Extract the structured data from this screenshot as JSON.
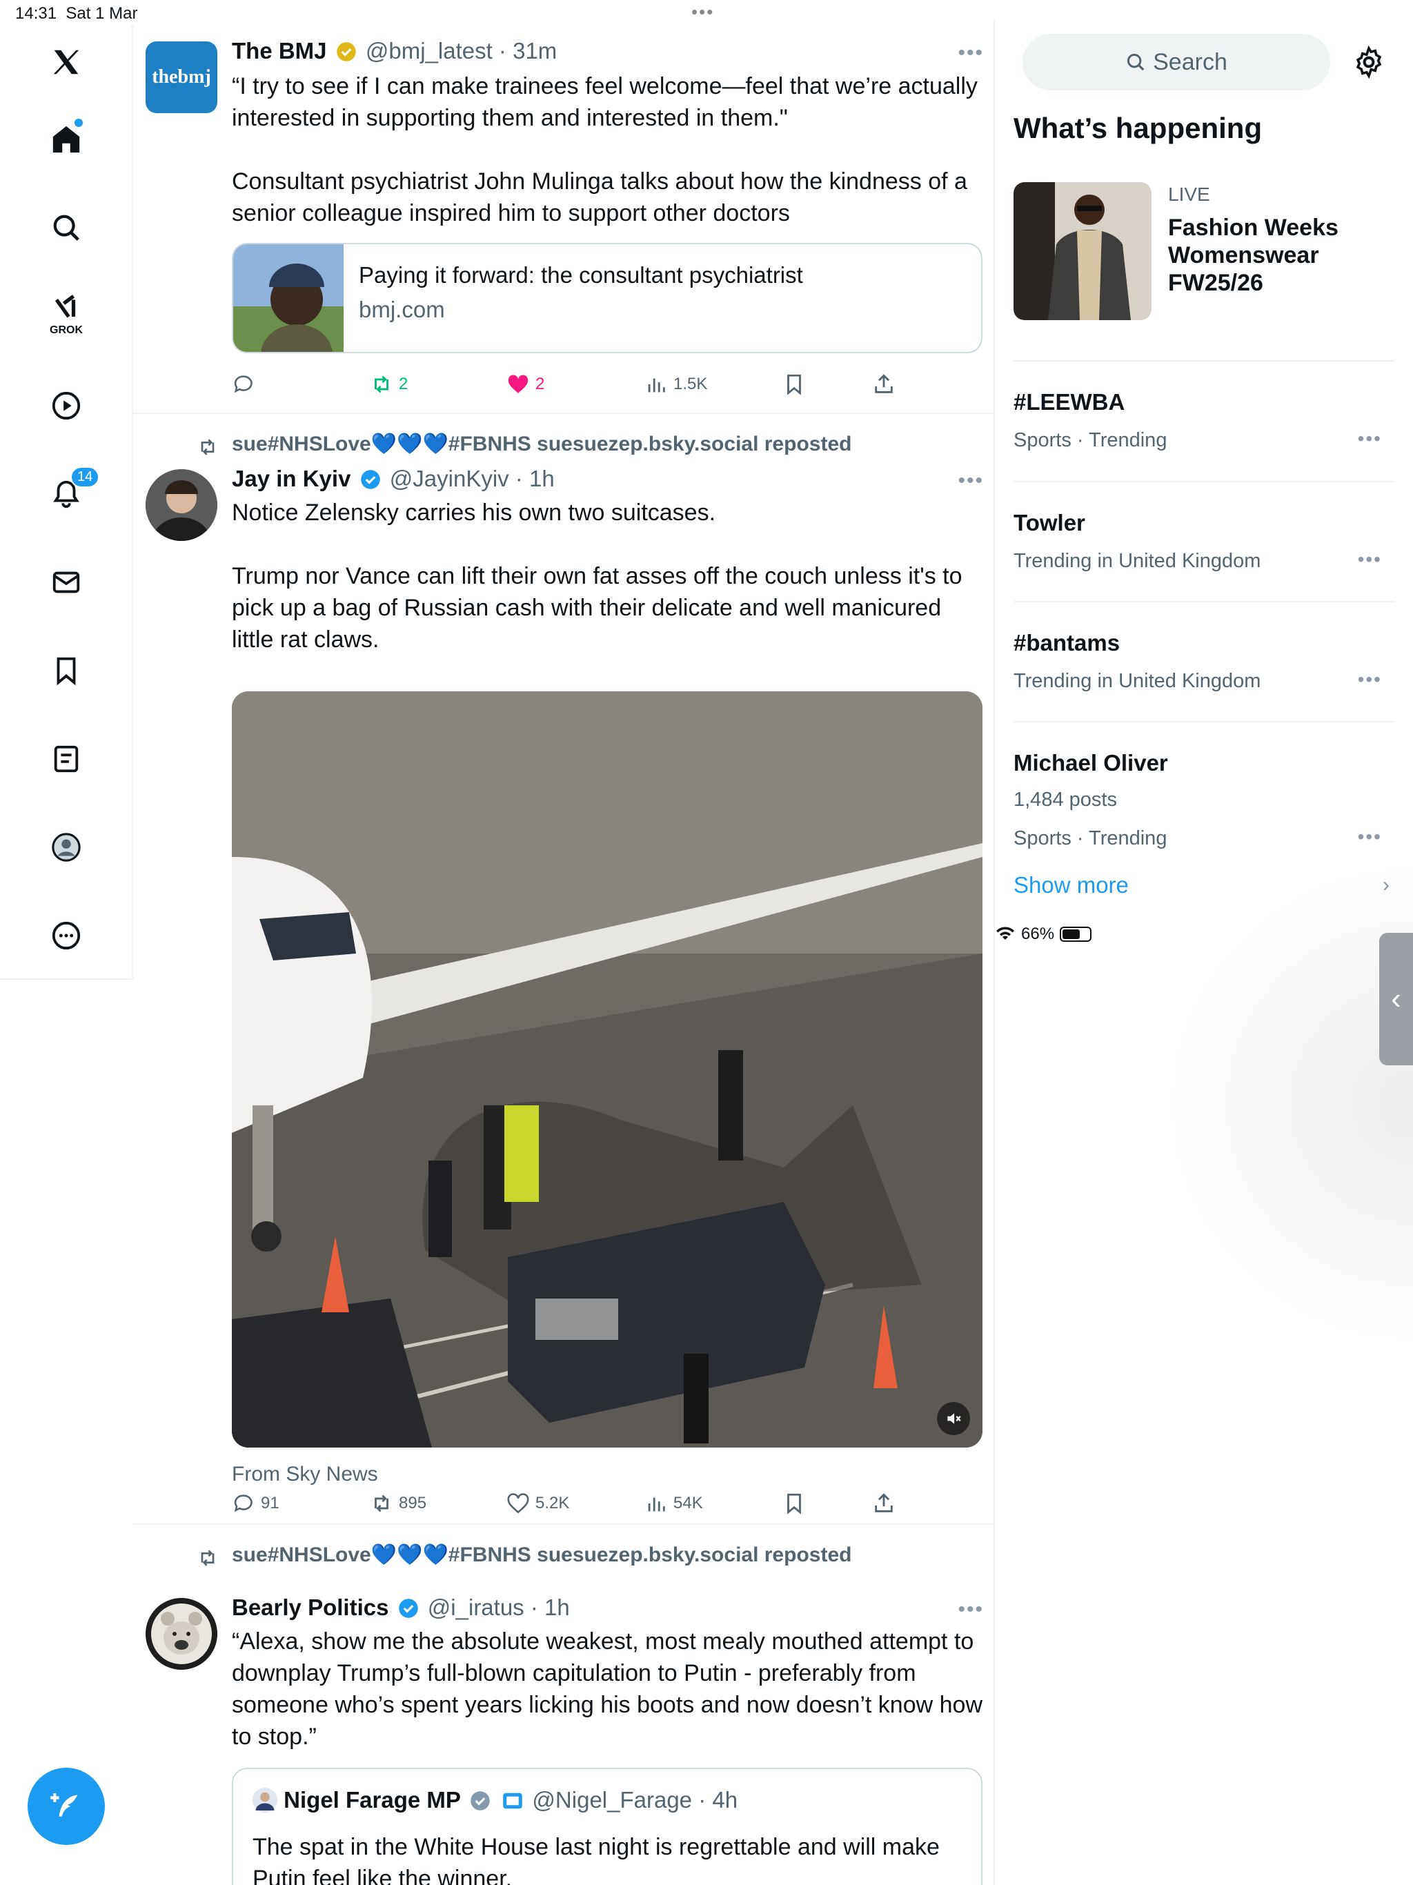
{
  "status_bar": {
    "time": "14:31",
    "date": "Sat 1 Mar",
    "battery": "66%",
    "battery_level": 0.66
  },
  "nav": {
    "items": [
      "x-logo",
      "home",
      "search",
      "grok",
      "video",
      "notifications",
      "messages",
      "bookmarks",
      "lists",
      "profile",
      "more"
    ],
    "grok_label": "GROK",
    "notifications_badge": "14"
  },
  "timeline": {
    "tweet1": {
      "name": "The BMJ",
      "handle": "@bmj_latest",
      "time": "31m",
      "avatar_text": "thebmj",
      "text_line1": "“I try to see if I can make trainees feel welcome—feel that we’re actually interested in supporting them and interested in them.\"",
      "text_line2": "Consultant psychiatrist John Mulinga talks about how the kindness of a senior colleague inspired him to support other doctors",
      "card_title": "Paying it forward: the consultant psychiatrist",
      "card_domain": "bmj.com",
      "reposts": "2",
      "likes": "2",
      "views": "1.5K"
    },
    "tweet2": {
      "repost_by": "sue#NHSLove💙💙💙#FBNHS suesuezep.bsky.social reposted",
      "name": "Jay in Kyiv",
      "handle": "@JayinKyiv",
      "time": "1h",
      "text_line1": "Notice Zelensky carries his own two suitcases.",
      "text_line2": "Trump nor Vance can lift their own fat asses off the couch unless it's to pick up a bag of Russian cash with their delicate and well manicured little rat claws.",
      "source": "From Sky News",
      "replies": "91",
      "reposts": "895",
      "likes": "5.2K",
      "views": "54K"
    },
    "tweet3": {
      "repost_by": "sue#NHSLove💙💙💙#FBNHS suesuezep.bsky.social reposted",
      "name": "Bearly Politics",
      "handle": "@i_iratus",
      "time": "1h",
      "text": "“Alexa, show me the absolute weakest, most mealy mouthed attempt to downplay Trump’s full-blown capitulation to Putin - preferably from someone who’s spent years licking his boots and now doesn’t know how to stop.”",
      "quote_name": "Nigel Farage MP",
      "quote_handle": "@Nigel_Farage",
      "quote_time": "4h",
      "quote_text": "The spat in the White House last night is regrettable and will make Putin feel like the winner."
    }
  },
  "sidebar": {
    "search_placeholder": "Search",
    "heading": "What’s happening",
    "live_label": "LIVE",
    "live_title": "Fashion Weeks Womenswear FW25/26",
    "trends": [
      {
        "name": "#LEEWBA",
        "meta": "Sports · Trending"
      },
      {
        "name": "Towler",
        "meta": "Trending in United Kingdom"
      },
      {
        "name": "#bantams",
        "meta": "Trending in United Kingdom"
      },
      {
        "name": "Michael Oliver",
        "posts": "1,484 posts",
        "meta": "Sports · Trending"
      }
    ],
    "show_more": "Show more"
  },
  "colors": {
    "accent": "#1d9bf0",
    "like": "#f91880",
    "repost": "#00ba7c",
    "muted": "#536471"
  }
}
